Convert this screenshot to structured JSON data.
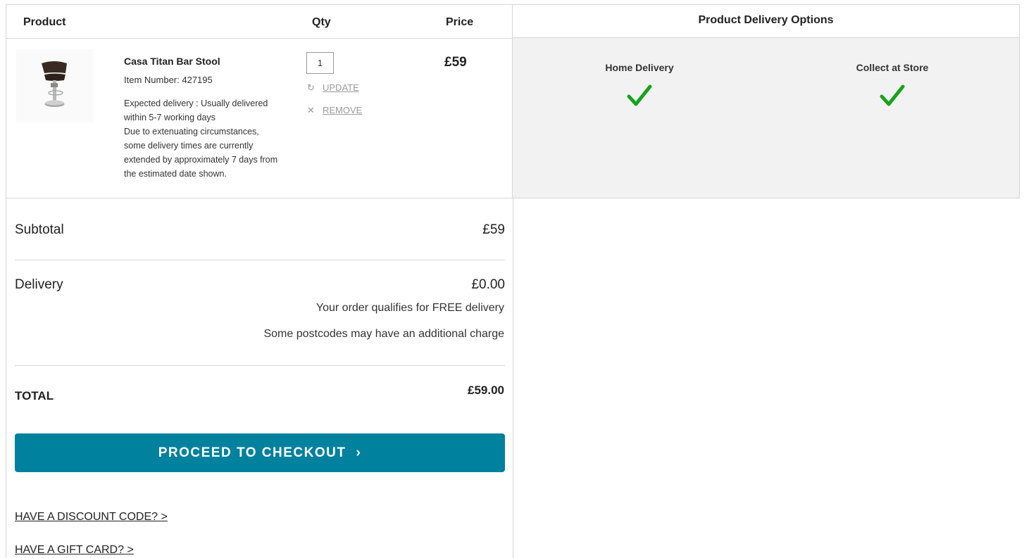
{
  "table": {
    "headers": {
      "product": "Product",
      "qty": "Qty",
      "price": "Price"
    },
    "item": {
      "name": "Casa Titan Bar Stool",
      "item_number": "Item Number: 427195",
      "expected_delivery": "Expected delivery : Usually delivered within 5-7 working days",
      "delay_note": "Due to extenuating circumstances, some delivery times are currently extended by approximately 7 days from the estimated date shown.",
      "quantity": "1",
      "update_label": "UPDATE",
      "remove_label": "REMOVE",
      "price": "£59"
    }
  },
  "delivery_options": {
    "title": "Product Delivery Options",
    "home": {
      "label": "Home Delivery",
      "icon": "check-icon",
      "available": true
    },
    "store": {
      "label": "Collect at Store",
      "icon": "check-icon",
      "available": true
    },
    "check_color": "#16a31a"
  },
  "summary": {
    "subtotal_label": "Subtotal",
    "subtotal_value": "£59",
    "delivery_label": "Delivery",
    "delivery_value": "£0.00",
    "free_delivery_note": "Your order qualifies for FREE delivery",
    "postcode_note": "Some postcodes may have an additional charge",
    "total_label": "TOTAL",
    "total_value": "£59.00",
    "checkout_label": "PROCEED TO CHECKOUT",
    "checkout_chevron": "›",
    "discount_link": "HAVE A DISCOUNT CODE? >",
    "gift_card_link": "HAVE A GIFT CARD? >"
  },
  "colors": {
    "accent": "#00819e",
    "panel_bg": "#f2f2f2",
    "border": "#d6d6d6"
  }
}
